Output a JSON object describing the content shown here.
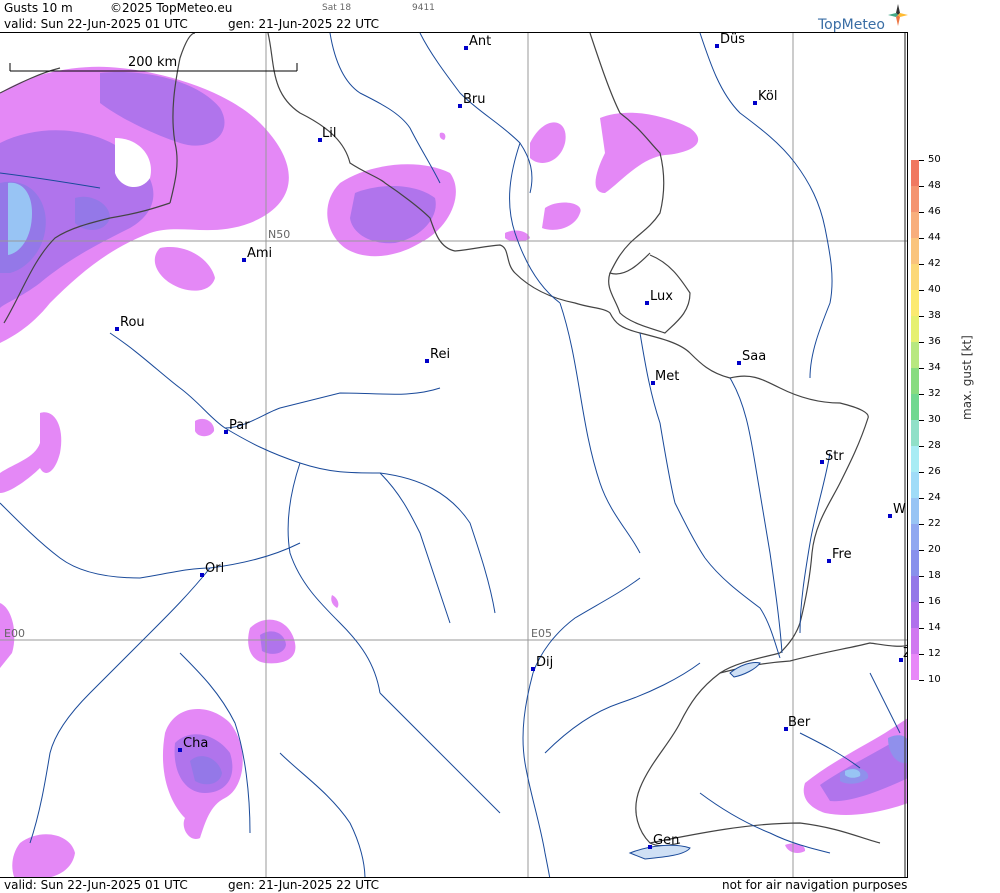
{
  "header": {
    "product": "Gusts 10 m",
    "copyright": "©2025 TopMeteo.eu",
    "day": "Sat 18",
    "code": "9411",
    "valid": "valid:  Sun  22-Jun-2025  01 UTC",
    "gen": "gen: 21-Jun-2025 22 UTC",
    "logo": "TopMeteo"
  },
  "map": {
    "scale_label": "200 km",
    "grid_labels": [
      "N50",
      "E00",
      "E05"
    ],
    "cities": [
      {
        "name": "Ant"
      },
      {
        "name": "Düs"
      },
      {
        "name": "Bru"
      },
      {
        "name": "Köl"
      },
      {
        "name": "Lil"
      },
      {
        "name": "Ami"
      },
      {
        "name": "Rou"
      },
      {
        "name": "Lux"
      },
      {
        "name": "Rei"
      },
      {
        "name": "Saa"
      },
      {
        "name": "Met"
      },
      {
        "name": "Par"
      },
      {
        "name": "Str"
      },
      {
        "name": "W"
      },
      {
        "name": "Fre"
      },
      {
        "name": "Orl"
      },
      {
        "name": "Dij"
      },
      {
        "name": "Z"
      },
      {
        "name": "Ber"
      },
      {
        "name": "Cha"
      },
      {
        "name": "Gen"
      }
    ]
  },
  "footer": {
    "valid": "valid:  Sun  22-Jun-2025  01 UTC",
    "gen": "gen: 21-Jun-2025 22 UTC",
    "disclaimer": "not for air navigation purposes"
  },
  "legend": {
    "title": "max. gust [kt]",
    "ticks": [
      "50",
      "48",
      "46",
      "44",
      "42",
      "40",
      "38",
      "36",
      "34",
      "32",
      "30",
      "28",
      "26",
      "24",
      "22",
      "20",
      "18",
      "16",
      "14",
      "12",
      "10"
    ],
    "colors": {
      "50": "#f07860",
      "48": "#f49470",
      "46": "#f8ae7c",
      "44": "#fac47c",
      "42": "#fcd878",
      "40": "#fcea70",
      "38": "#e6f070",
      "36": "#b8e880",
      "34": "#88dc80",
      "32": "#70d890",
      "30": "#90e0c8",
      "28": "#a8ecf4",
      "26": "#a0dcf8",
      "24": "#98c4f4",
      "22": "#90a8f0",
      "20": "#8890ec",
      "18": "#9478e8",
      "16": "#b070ec",
      "14": "#d078f0",
      "12": "#e888f8"
    }
  }
}
